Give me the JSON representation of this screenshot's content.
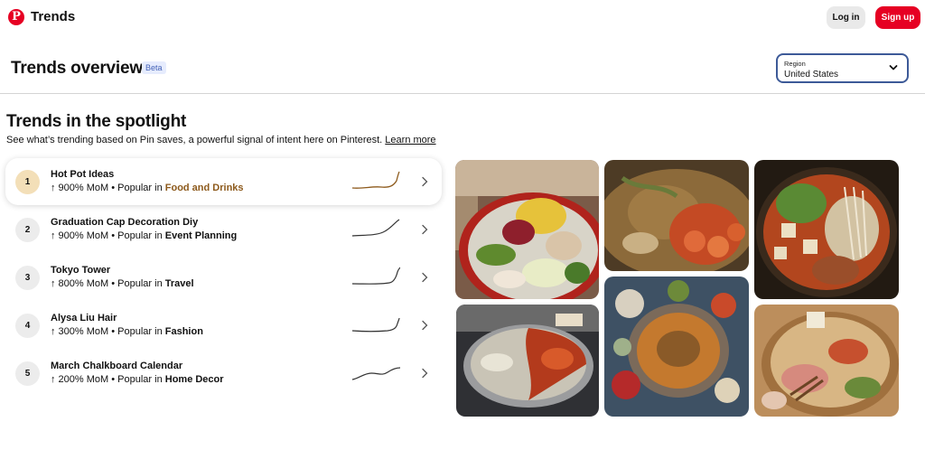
{
  "topbar": {
    "app_title": "Trends",
    "logo_letter": "P",
    "login_label": "Log in",
    "signup_label": "Sign up"
  },
  "header": {
    "title": "Trends overview",
    "badge": "Beta",
    "region_label": "Region",
    "region_value": "United States"
  },
  "spotlight": {
    "title": "Trends in the spotlight",
    "description": "See what’s trending based on Pin saves, a powerful signal of intent here on Pinterest.",
    "learn_more": "Learn more",
    "trends": [
      {
        "rank": "1",
        "name": "Hot Pot Ideas",
        "change": "↑ 900% MoM • Popular in",
        "category": "Food and Drinks"
      },
      {
        "rank": "2",
        "name": "Graduation Cap Decoration Diy",
        "change": "↑ 900% MoM • Popular in",
        "category": "Event Planning"
      },
      {
        "rank": "3",
        "name": "Tokyo Tower",
        "change": "↑ 800% MoM • Popular in",
        "category": "Travel"
      },
      {
        "rank": "4",
        "name": "Alysa Liu Hair",
        "change": "↑ 300% MoM • Popular in",
        "category": "Fashion"
      },
      {
        "rank": "5",
        "name": "March Chalkboard Calendar",
        "change": "↑ 200% MoM • Popular in",
        "category": "Home Decor"
      }
    ]
  },
  "colors": {
    "brand": "#e60023",
    "active_category": "#8d5a1c",
    "rank_active_bg": "#f3dfb8",
    "badge_bg": "#e6ecfd",
    "sparkline": "#6b4a22"
  },
  "icons": {
    "logo": "pinterest-logo",
    "region": "chevron-down-icon",
    "row": "chevron-right-icon"
  }
}
